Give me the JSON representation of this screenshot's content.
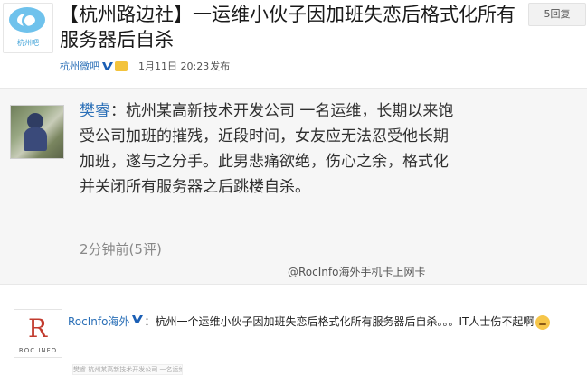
{
  "header": {
    "avatar_label": "杭州吧",
    "title": "【杭州路边社】一运维小伙子因加班失恋后格式化所有服务器后自杀",
    "reply_button": "5回复",
    "author": "杭州微吧",
    "time": "1月11日 20:23",
    "published": "发布"
  },
  "post": {
    "username": "樊睿",
    "body": "：杭州某高新技术开发公司 一名运维，长期以来饱受公司加班的摧残，近段时间，女友应无法忍受他长期加班，遂与之分手。此男悲痛欲绝，伤心之余，格式化并关闭所有服务器之后跳楼自杀。",
    "footer": "2分钟前(5评)",
    "watermark": "@RocInfo海外手机卡上网卡"
  },
  "comment": {
    "avatar_text": "ROC INFO",
    "avatar_mark": "R",
    "user": "RocInfo海外",
    "text": "：杭州一个运维小伙子因加班失恋后格式化所有服务器后自杀。。。IT人士伤不起啊",
    "thumb_text": "樊睿 杭州某高新技术开发公司 一名运维"
  },
  "colors": {
    "link": "#2a6fb7",
    "post_bg": "#f6f6f6",
    "brand": "#6fc2ec"
  }
}
